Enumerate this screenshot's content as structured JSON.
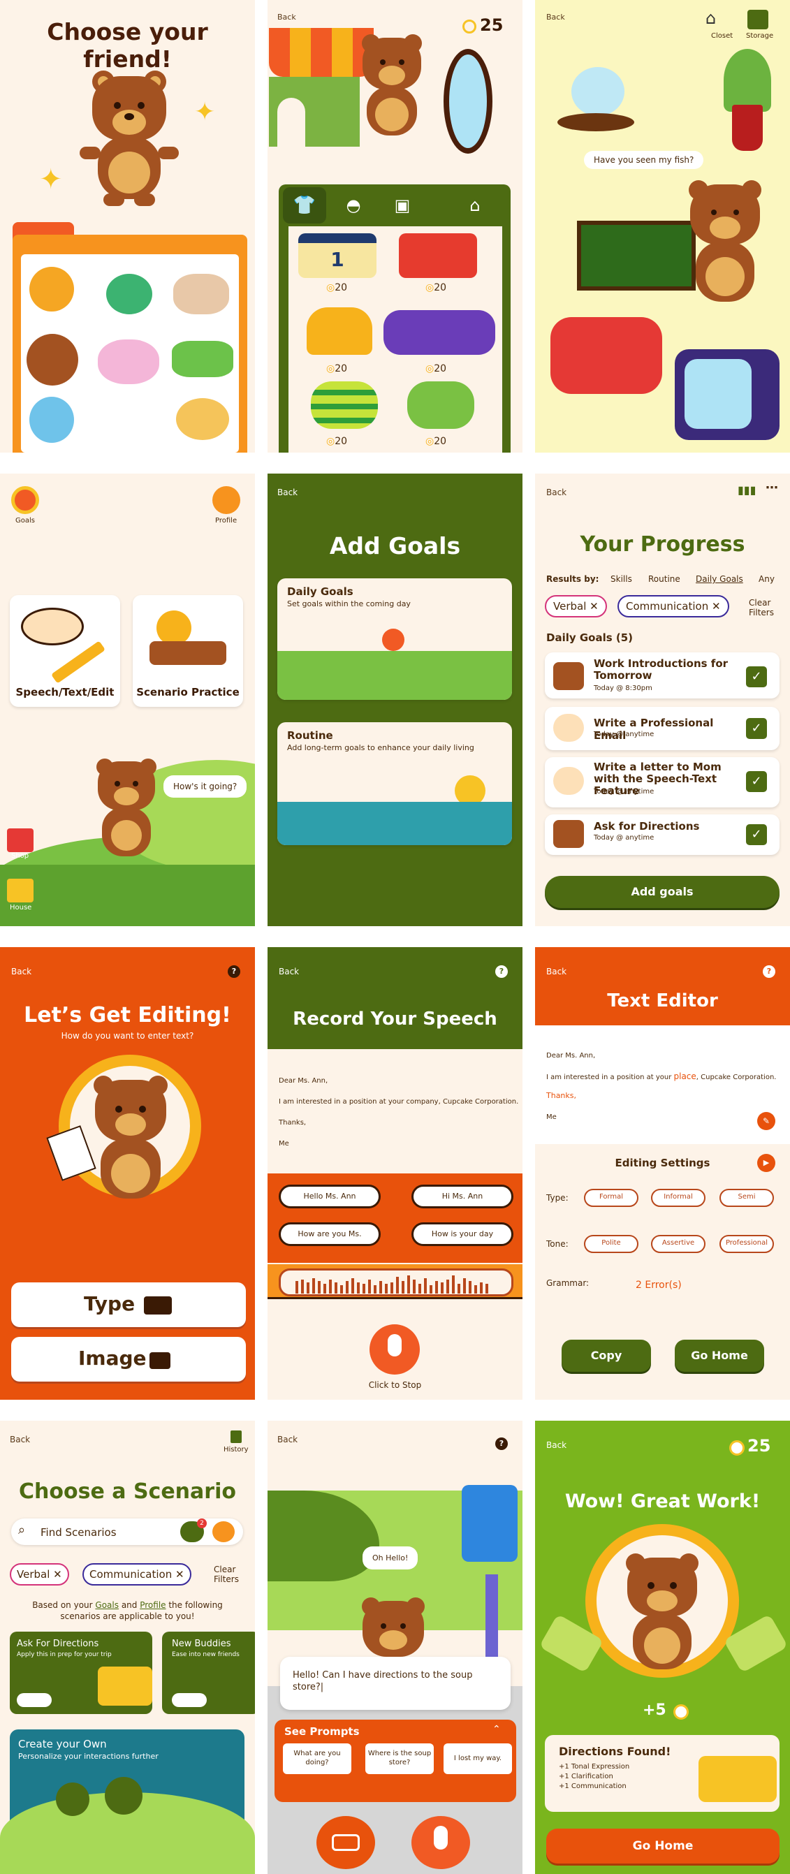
{
  "s1": {
    "title": "Choose your friend!"
  },
  "s2": {
    "back": "Back",
    "coins": "25",
    "items": [
      {
        "price": "20"
      },
      {
        "price": "20"
      },
      {
        "price": "20"
      },
      {
        "price": "20"
      },
      {
        "price": "20"
      },
      {
        "price": "20"
      }
    ],
    "jersey_number": "1"
  },
  "s3": {
    "back": "Back",
    "closet": "Closet",
    "storage": "Storage",
    "speech": "Have you seen my fish?"
  },
  "s4": {
    "goals": "Goals",
    "profile": "Profile",
    "card1": "Speech/Text/Edit",
    "card2": "Scenario Practice",
    "speech": "How's it going?",
    "shop": "Shop",
    "house": "House"
  },
  "s5": {
    "back": "Back",
    "title": "Add Goals",
    "daily_title": "Daily Goals",
    "daily_sub": "Set goals within the coming day",
    "routine_title": "Routine",
    "routine_sub": "Add long-term goals to enhance your daily living"
  },
  "s6": {
    "back": "Back",
    "title": "Your Progress",
    "results_by": "Results by:",
    "tabs": [
      "Skills",
      "Routine",
      "Daily Goals",
      "Any"
    ],
    "chips": [
      "Verbal",
      "Communication"
    ],
    "clear": "Clear Filters",
    "section": "Daily Goals (5)",
    "goals": [
      {
        "title": "Work Introductions for Tomorrow",
        "time": "Today @ 8:30pm"
      },
      {
        "title": "Write a Professional Email",
        "time": "Today @ anytime"
      },
      {
        "title": "Write a letter to Mom with the Speech-Text Feature",
        "time": "Today @ anytime"
      },
      {
        "title": "Ask for Directions",
        "time": "Today @ anytime"
      }
    ],
    "add": "Add goals"
  },
  "s7": {
    "back": "Back",
    "title": "Let’s Get Editing!",
    "sub": "How do you want to enter text?",
    "type": "Type",
    "image": "Image"
  },
  "s8": {
    "back": "Back",
    "title": "Record Your Speech",
    "letter": [
      "Dear Ms. Ann,",
      "I am interested in a position at your company, Cupcake Corporation.",
      "Thanks,",
      "Me"
    ],
    "options": [
      "Hello Ms. Ann",
      "Hi Ms. Ann",
      "How are you Ms.",
      "How is your day"
    ],
    "stop": "Click to Stop"
  },
  "s9": {
    "back": "Back",
    "title": "Text Editor",
    "letter1": "Dear Ms. Ann,",
    "letter2a": "I am interested in a position at your ",
    "letter2b": "place",
    "letter2c": ", Cupcake Corporation.",
    "letter3": "Thanks,",
    "letter4": "Me",
    "settings": "Editing Settings",
    "type_label": "Type:",
    "types": [
      "Formal",
      "Informal",
      "Semi"
    ],
    "tone_label": "Tone:",
    "tones": [
      "Polite",
      "Assertive",
      "Professional"
    ],
    "grammar": "Grammar:",
    "errors": "2 Error(s)",
    "copy": "Copy",
    "home": "Go Home"
  },
  "s10": {
    "back": "Back",
    "history": "History",
    "title": "Choose a Scenario",
    "search": "Find Scenarios",
    "badge": "2",
    "chips": [
      "Verbal",
      "Communication"
    ],
    "clear": "Clear Filters",
    "based1": "Based on your ",
    "goals": "Goals",
    "and": " and ",
    "profile": "Profile",
    "based2": " the following",
    "based3": "scenarios are applicable to you!",
    "c1_title": "Ask For Directions",
    "c1_sub": "Apply this in prep for your trip",
    "c2_title": "New Buddies",
    "c2_sub": "Ease into new friends",
    "c3_title": "Create your Own",
    "c3_sub": "Personalize your interactions further"
  },
  "s11": {
    "back": "Back",
    "hello": "Oh Hello!",
    "speech": "Hello! Can I have directions to the soup store?|",
    "prompts": "See Prompts",
    "p": [
      "What are you doing?",
      "Where is the soup store?",
      "I lost my way."
    ]
  },
  "s12": {
    "back": "Back",
    "coins": "25",
    "title": "Wow! Great Work!",
    "reward": "+5",
    "found": "Directions Found!",
    "bullets": [
      "+1 Tonal Expression",
      "+1 Clarification",
      "+1 Communication"
    ],
    "home": "Go Home"
  }
}
